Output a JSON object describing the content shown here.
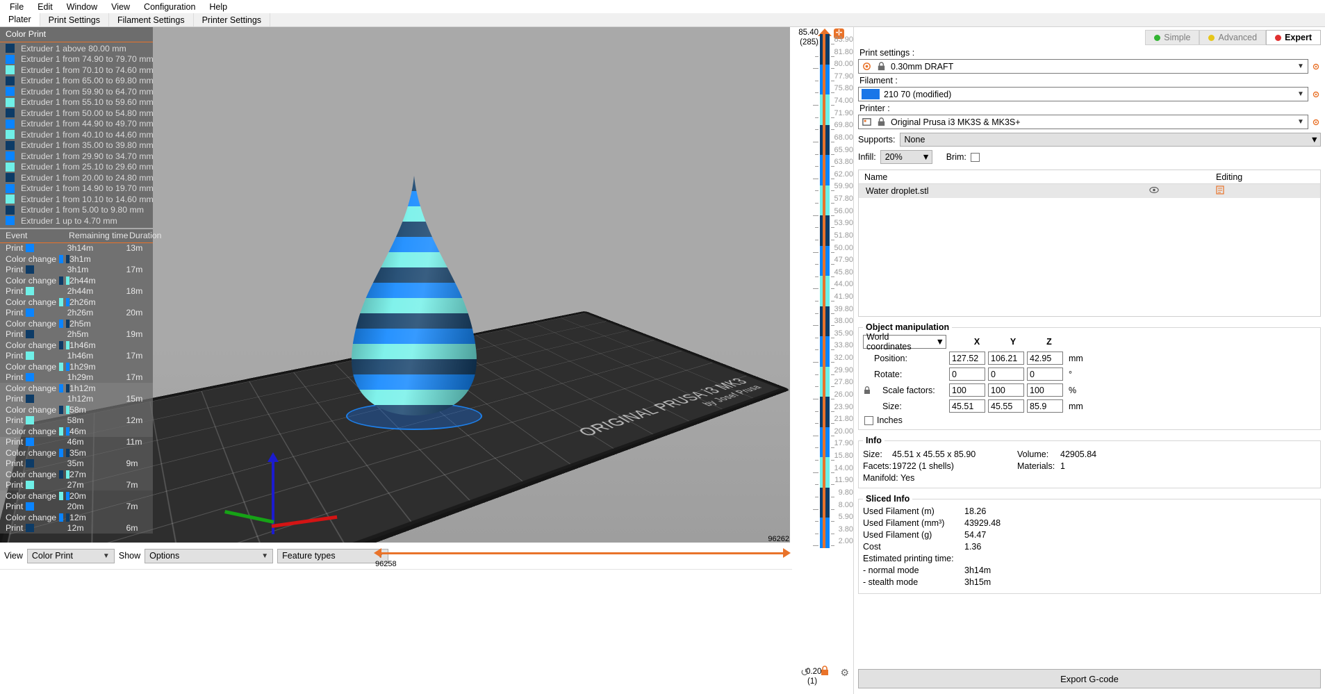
{
  "menu": {
    "items": [
      "File",
      "Edit",
      "Window",
      "View",
      "Configuration",
      "Help"
    ]
  },
  "tabs": [
    {
      "label": "Plater",
      "active": true
    },
    {
      "label": "Print Settings",
      "active": false
    },
    {
      "label": "Filament Settings",
      "active": false
    },
    {
      "label": "Printer Settings",
      "active": false
    }
  ],
  "legend": {
    "title": "Color Print",
    "rows": [
      {
        "color": "#0d3b66",
        "label": "Extruder 1 above 80.00 mm"
      },
      {
        "color": "#0a84ff",
        "label": "Extruder 1 from 74.90 to 79.70 mm"
      },
      {
        "color": "#6ff0e8",
        "label": "Extruder 1 from 70.10 to 74.60 mm"
      },
      {
        "color": "#0d3b66",
        "label": "Extruder 1 from 65.00 to 69.80 mm"
      },
      {
        "color": "#0a84ff",
        "label": "Extruder 1 from 59.90 to 64.70 mm"
      },
      {
        "color": "#6ff0e8",
        "label": "Extruder 1 from 55.10 to 59.60 mm"
      },
      {
        "color": "#0d3b66",
        "label": "Extruder 1 from 50.00 to 54.80 mm"
      },
      {
        "color": "#0a84ff",
        "label": "Extruder 1 from 44.90 to 49.70 mm"
      },
      {
        "color": "#6ff0e8",
        "label": "Extruder 1 from 40.10 to 44.60 mm"
      },
      {
        "color": "#0d3b66",
        "label": "Extruder 1 from 35.00 to 39.80 mm"
      },
      {
        "color": "#0a84ff",
        "label": "Extruder 1 from 29.90 to 34.70 mm"
      },
      {
        "color": "#6ff0e8",
        "label": "Extruder 1 from 25.10 to 29.60 mm"
      },
      {
        "color": "#0d3b66",
        "label": "Extruder 1 from 20.00 to 24.80 mm"
      },
      {
        "color": "#0a84ff",
        "label": "Extruder 1 from 14.90 to 19.70 mm"
      },
      {
        "color": "#6ff0e8",
        "label": "Extruder 1 from 10.10 to 14.60 mm"
      },
      {
        "color": "#0d3b66",
        "label": "Extruder 1 from 5.00 to 9.80 mm"
      },
      {
        "color": "#0a84ff",
        "label": "Extruder 1 up to 4.70 mm"
      }
    ]
  },
  "events": {
    "headers": [
      "Event",
      "Remaining time",
      "Duration"
    ],
    "rows": [
      {
        "type": "Print",
        "colors": [
          "#0a84ff"
        ],
        "remaining": "3h14m",
        "duration": "13m"
      },
      {
        "type": "Color change",
        "colors": [
          "#0a84ff",
          "#0d3b66"
        ],
        "remaining": "3h1m",
        "duration": ""
      },
      {
        "type": "Print",
        "colors": [
          "#0d3b66"
        ],
        "remaining": "3h1m",
        "duration": "17m"
      },
      {
        "type": "Color change",
        "colors": [
          "#0d3b66",
          "#6ff0e8"
        ],
        "remaining": "2h44m",
        "duration": ""
      },
      {
        "type": "Print",
        "colors": [
          "#6ff0e8"
        ],
        "remaining": "2h44m",
        "duration": "18m"
      },
      {
        "type": "Color change",
        "colors": [
          "#6ff0e8",
          "#0a84ff"
        ],
        "remaining": "2h26m",
        "duration": ""
      },
      {
        "type": "Print",
        "colors": [
          "#0a84ff"
        ],
        "remaining": "2h26m",
        "duration": "20m"
      },
      {
        "type": "Color change",
        "colors": [
          "#0a84ff",
          "#0d3b66"
        ],
        "remaining": "2h5m",
        "duration": ""
      },
      {
        "type": "Print",
        "colors": [
          "#0d3b66"
        ],
        "remaining": "2h5m",
        "duration": "19m"
      },
      {
        "type": "Color change",
        "colors": [
          "#0d3b66",
          "#6ff0e8"
        ],
        "remaining": "1h46m",
        "duration": ""
      },
      {
        "type": "Print",
        "colors": [
          "#6ff0e8"
        ],
        "remaining": "1h46m",
        "duration": "17m"
      },
      {
        "type": "Color change",
        "colors": [
          "#6ff0e8",
          "#0a84ff"
        ],
        "remaining": "1h29m",
        "duration": ""
      },
      {
        "type": "Print",
        "colors": [
          "#0a84ff"
        ],
        "remaining": "1h29m",
        "duration": "17m"
      },
      {
        "type": "Color change",
        "colors": [
          "#0a84ff",
          "#0d3b66"
        ],
        "remaining": "1h12m",
        "duration": ""
      },
      {
        "type": "Print",
        "colors": [
          "#0d3b66"
        ],
        "remaining": "1h12m",
        "duration": "15m"
      },
      {
        "type": "Color change",
        "colors": [
          "#0d3b66",
          "#6ff0e8"
        ],
        "remaining": "58m",
        "duration": ""
      },
      {
        "type": "Print",
        "colors": [
          "#6ff0e8"
        ],
        "remaining": "58m",
        "duration": "12m"
      },
      {
        "type": "Color change",
        "colors": [
          "#6ff0e8",
          "#0a84ff"
        ],
        "remaining": "46m",
        "duration": ""
      },
      {
        "type": "Print",
        "colors": [
          "#0a84ff"
        ],
        "remaining": "46m",
        "duration": "11m"
      },
      {
        "type": "Color change",
        "colors": [
          "#0a84ff",
          "#0d3b66"
        ],
        "remaining": "35m",
        "duration": ""
      },
      {
        "type": "Print",
        "colors": [
          "#0d3b66"
        ],
        "remaining": "35m",
        "duration": "9m"
      },
      {
        "type": "Color change",
        "colors": [
          "#0d3b66",
          "#6ff0e8"
        ],
        "remaining": "27m",
        "duration": ""
      },
      {
        "type": "Print",
        "colors": [
          "#6ff0e8"
        ],
        "remaining": "27m",
        "duration": "7m"
      },
      {
        "type": "Color change",
        "colors": [
          "#6ff0e8",
          "#0a84ff"
        ],
        "remaining": "20m",
        "duration": ""
      },
      {
        "type": "Print",
        "colors": [
          "#0a84ff"
        ],
        "remaining": "20m",
        "duration": "7m"
      },
      {
        "type": "Color change",
        "colors": [
          "#0a84ff",
          "#0d3b66"
        ],
        "remaining": "12m",
        "duration": ""
      },
      {
        "type": "Print",
        "colors": [
          "#0d3b66"
        ],
        "remaining": "12m",
        "duration": "6m"
      }
    ]
  },
  "viewport": {
    "bed_brand": "ORIGINAL PRUSA i3 MK3",
    "bed_author": "by Josef Prusa"
  },
  "bottom": {
    "view_label": "View",
    "view_value": "Color Print",
    "show_label": "Show",
    "show_value": "Options",
    "feature_value": "Feature types",
    "slider_max": "96262",
    "slider_min": "96258"
  },
  "layer_slider": {
    "top_value": "85.40",
    "top_index": "(285)",
    "bottom_value": "0.20",
    "bottom_index": "(1)",
    "ticks": [
      "83.90",
      "81.80",
      "80.00",
      "77.90",
      "75.80",
      "74.00",
      "71.90",
      "69.80",
      "68.00",
      "65.90",
      "63.80",
      "62.00",
      "59.90",
      "57.80",
      "56.00",
      "53.90",
      "51.80",
      "50.00",
      "47.90",
      "45.80",
      "44.00",
      "41.90",
      "39.80",
      "38.00",
      "35.90",
      "33.80",
      "32.00",
      "29.90",
      "27.80",
      "26.00",
      "23.90",
      "21.80",
      "20.00",
      "17.90",
      "15.80",
      "14.00",
      "11.90",
      "9.80",
      "8.00",
      "5.90",
      "3.80",
      "2.00"
    ]
  },
  "modes": [
    {
      "label": "Simple",
      "color": "#32b432",
      "active": false
    },
    {
      "label": "Advanced",
      "color": "#e6c619",
      "active": false
    },
    {
      "label": "Expert",
      "color": "#e03030",
      "active": true
    }
  ],
  "settings": {
    "print_label": "Print settings :",
    "print_value": "0.30mm DRAFT",
    "filament_label": "Filament :",
    "filament_value": "210 70 (modified)",
    "filament_color": "#1976e8",
    "printer_label": "Printer :",
    "printer_value": "Original Prusa i3 MK3S & MK3S+",
    "supports_label": "Supports:",
    "supports_value": "None",
    "infill_label": "Infill:",
    "infill_value": "20%",
    "brim_label": "Brim:"
  },
  "object_list": {
    "headers": [
      "Name",
      "",
      "Editing"
    ],
    "rows": [
      {
        "name": "Water droplet.stl",
        "eye": "eye-icon",
        "edit": "edit-icon"
      }
    ]
  },
  "object_manipulation": {
    "title": "Object manipulation",
    "coord_system": "World coordinates",
    "axes": [
      "X",
      "Y",
      "Z"
    ],
    "rows": [
      {
        "label": "Position:",
        "indent": false,
        "values": [
          "127.52",
          "106.21",
          "42.95"
        ],
        "unit": "mm"
      },
      {
        "label": "Rotate:",
        "indent": false,
        "values": [
          "0",
          "0",
          "0"
        ],
        "unit": "°"
      },
      {
        "label": "Scale factors:",
        "indent": true,
        "values": [
          "100",
          "100",
          "100"
        ],
        "unit": "%"
      },
      {
        "label": "Size:",
        "indent": true,
        "values": [
          "45.51",
          "45.55",
          "85.9"
        ],
        "unit": "mm"
      }
    ],
    "inches_label": "Inches"
  },
  "info": {
    "title": "Info",
    "size_label": "Size:",
    "size_value": "45.51 x 45.55 x 85.90",
    "volume_label": "Volume:",
    "volume_value": "42905.84",
    "facets_label": "Facets:",
    "facets_value": "19722 (1 shells)",
    "materials_label": "Materials:",
    "materials_value": "1",
    "manifold_label": "Manifold: Yes"
  },
  "sliced_info": {
    "title": "Sliced Info",
    "rows": [
      {
        "label": "Used Filament (m)",
        "value": "18.26"
      },
      {
        "label": "Used Filament (mm³)",
        "value": "43929.48"
      },
      {
        "label": "Used Filament (g)",
        "value": "54.47"
      },
      {
        "label": "Cost",
        "value": "1.36"
      },
      {
        "label": "Estimated printing time:",
        "value": ""
      },
      {
        "label": " - normal mode",
        "value": "3h14m"
      },
      {
        "label": " - stealth mode",
        "value": "3h15m"
      }
    ]
  },
  "export": {
    "label": "Export G-code"
  }
}
